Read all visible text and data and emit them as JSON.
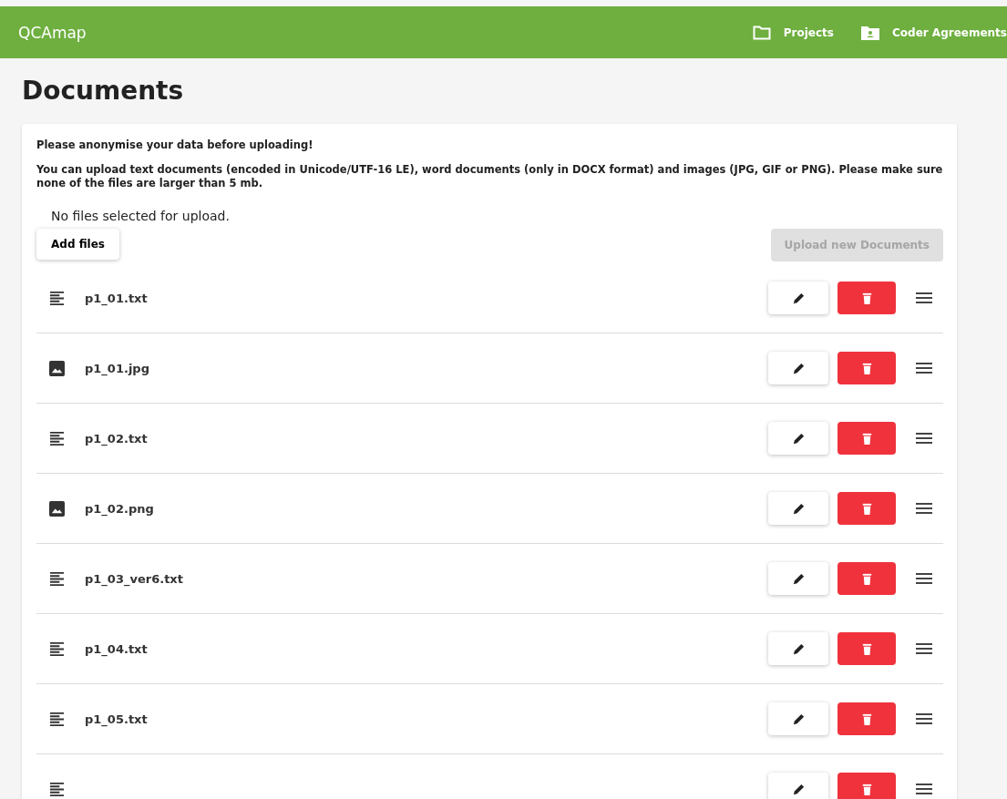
{
  "app_bar": {
    "title": "QCAmap",
    "links": [
      {
        "label": "Projects",
        "kind": "folder"
      },
      {
        "label": "Coder Agreements",
        "kind": "person-folder"
      }
    ]
  },
  "page_title": "Documents",
  "notice": "Please anonymise your data before uploading!",
  "info": "You can upload text documents (encoded in Unicode/UTF-16 LE), word documents (only in DOCX format) and images (JPG, GIF or PNG). Please make sure none of the files are larger than 5 mb.",
  "upload_status": "No files selected for upload.",
  "add_button": "Add files",
  "upload_button": {
    "label": "Upload new Documents",
    "disabled": true
  },
  "documents": [
    {
      "kind": "text",
      "name": "p1_01.txt"
    },
    {
      "kind": "image",
      "name": "p1_01.jpg"
    },
    {
      "kind": "text",
      "name": "p1_02.txt"
    },
    {
      "kind": "image",
      "name": "p1_02.png"
    },
    {
      "kind": "text",
      "name": "p1_03_ver6.txt"
    },
    {
      "kind": "text",
      "name": "p1_04.txt"
    },
    {
      "kind": "text",
      "name": "p1_05.txt"
    },
    {
      "kind": "text"
    }
  ]
}
